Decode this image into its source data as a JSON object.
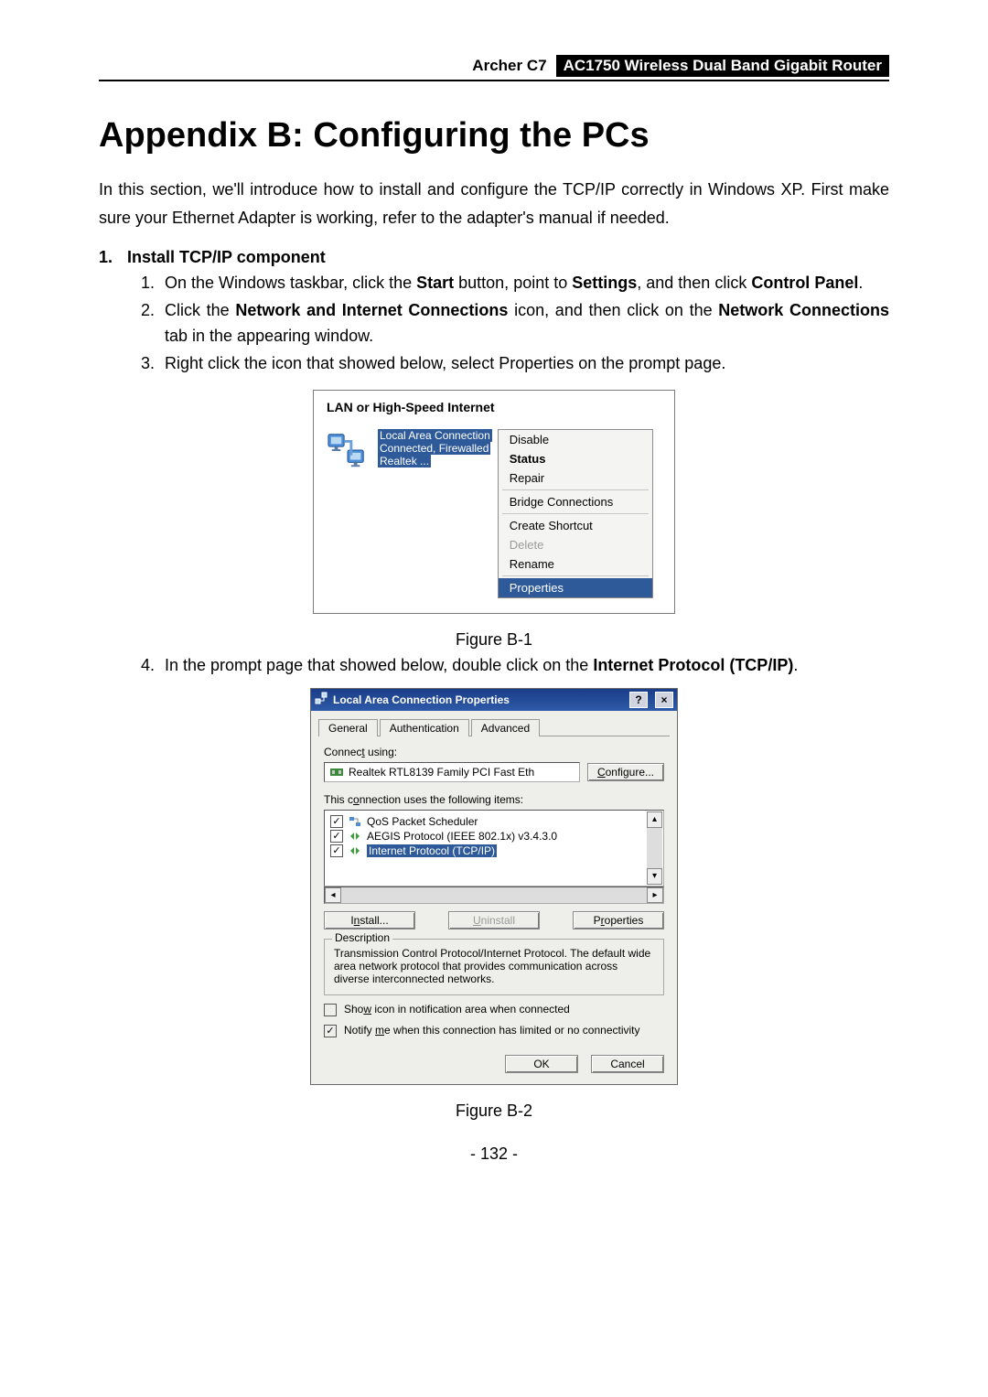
{
  "header": {
    "left": "Archer C7",
    "right": "AC1750 Wireless Dual Band Gigabit Router"
  },
  "title": "Appendix B: Configuring the PCs",
  "intro_1": "In this section, we'll introduce how to install and configure the TCP/IP correctly in Windows XP. First make sure your Ethernet Adapter is working, refer to the adapter's manual if needed.",
  "section": {
    "num": "1.",
    "head": "Install TCP/IP component"
  },
  "steps": {
    "s1_a": "On the Windows taskbar, click the ",
    "s1_b": "Start",
    "s1_c": " button, point to ",
    "s1_d": "Settings",
    "s1_e": ", and then click ",
    "s1_f": "Control Panel",
    "s1_g": ".",
    "s2_a": "Click the ",
    "s2_b": "Network and Internet Connections",
    "s2_c": " icon, and then click on the ",
    "s2_d": "Network Connections",
    "s2_e": " tab in the appearing window.",
    "s3": "Right click the icon that showed below, select Properties on the prompt page.",
    "s4_a": "In the prompt page that showed below, double click on the ",
    "s4_b": "Internet Protocol (TCP/IP)",
    "s4_c": "."
  },
  "fig_b1": {
    "group_label": "LAN or High-Speed Internet",
    "conn_name": "Local Area Connection",
    "conn_status": "Connected, Firewalled",
    "conn_adapter": "Realtek ...",
    "menu": {
      "disable": "Disable",
      "status": "Status",
      "repair": "Repair",
      "bridge": "Bridge Connections",
      "shortcut": "Create Shortcut",
      "delete": "Delete",
      "rename": "Rename",
      "properties": "Properties"
    },
    "caption": "Figure B-1"
  },
  "fig_b2": {
    "title_icon": "↕",
    "title": "Local Area Connection   Properties",
    "help": "?",
    "close": "×",
    "tabs": {
      "general": "General",
      "auth": "Authentication",
      "advanced": "Advanced"
    },
    "connect_using": "Connect using:",
    "adapter": "Realtek RTL8139 Family PCI Fast Eth",
    "configure": "Configure...",
    "items_label": "This connection uses the following items:",
    "items": {
      "qos": "QoS Packet Scheduler",
      "aegis": "AEGIS Protocol (IEEE 802.1x) v3.4.3.0",
      "tcpip": "Internet Protocol (TCP/IP)"
    },
    "install": "Install...",
    "uninstall": "Uninstall",
    "properties": "Properties",
    "desc_legend": "Description",
    "desc_text": "Transmission Control Protocol/Internet Protocol. The default wide area network protocol that provides communication across diverse interconnected networks.",
    "show_icon": "Show icon in notification area when connected",
    "notify": "Notify me when this connection has limited or no connectivity",
    "ok": "OK",
    "cancel": "Cancel",
    "caption": "Figure B-2"
  },
  "page_number": "- 132 -"
}
